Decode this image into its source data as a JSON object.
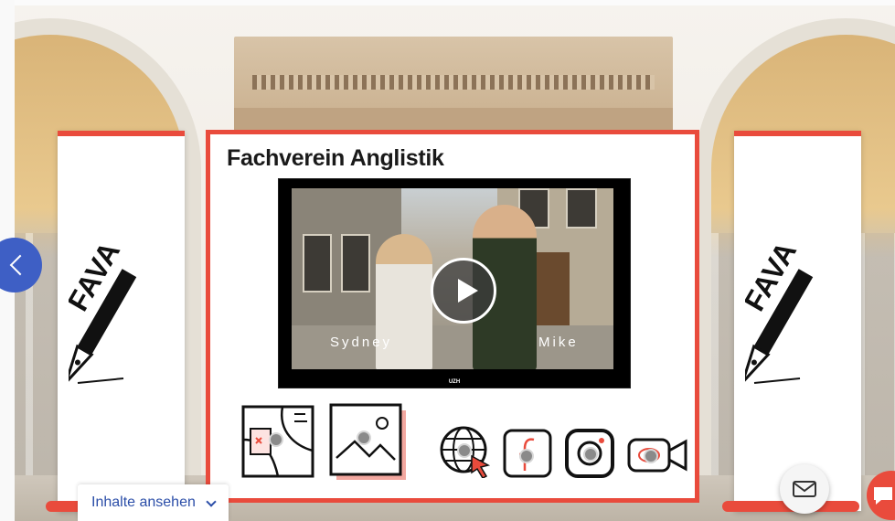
{
  "board": {
    "title": "Fachverein Anglistik"
  },
  "banner": {
    "logo_text": "FAVA"
  },
  "video": {
    "left_name": "Sydney",
    "right_name": "Mike",
    "watermark": "UZH"
  },
  "icons": [
    "map-icon",
    "gallery-icon",
    "website-icon",
    "facebook-icon",
    "instagram-icon",
    "video-call-icon"
  ],
  "footer": {
    "inhalte_label": "Inhalte ansehen"
  },
  "colors": {
    "accent": "#e94b3c",
    "nav": "#3e5fc5",
    "link": "#2b4ea8"
  }
}
